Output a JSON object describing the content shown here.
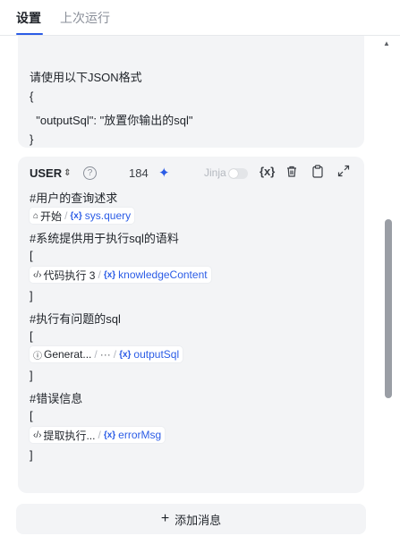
{
  "tabs": [
    {
      "label": "设置",
      "active": true
    },
    {
      "label": "上次运行",
      "active": false
    }
  ],
  "prev_card": {
    "lines": [
      "请使用以下JSON格式",
      "{",
      "  \"outputSql\": \"放置你输出的sql\"",
      "}"
    ]
  },
  "user_card": {
    "role": "USER",
    "token_count": "184",
    "jinja_label": "Jinja",
    "jinja_enabled": false,
    "texts": {
      "t1": "#用户的查询述求",
      "t2": "#系统提供用于执行sql的语料",
      "t3": "[",
      "t4": "]",
      "t5": "#执行有问题的sql",
      "t6": "[",
      "t7": "]",
      "t8": "#错误信息",
      "t9": "[",
      "t10": "]"
    },
    "chips": [
      {
        "source": "开始",
        "source_icon": "home-icon",
        "extra": "",
        "variable": "sys.query"
      },
      {
        "source": "代码执行 3",
        "source_icon": "code-icon",
        "extra": "",
        "variable": "knowledgeContent"
      },
      {
        "source": "Generat...",
        "source_icon": "info-icon",
        "extra": "···",
        "variable": "outputSql"
      },
      {
        "source": "提取执行...",
        "source_icon": "code-icon",
        "extra": "",
        "variable": "errorMsg"
      }
    ]
  },
  "add_message_label": "添加消息",
  "colors": {
    "accent": "#2b5ce6",
    "card_bg": "#f3f4f6"
  }
}
